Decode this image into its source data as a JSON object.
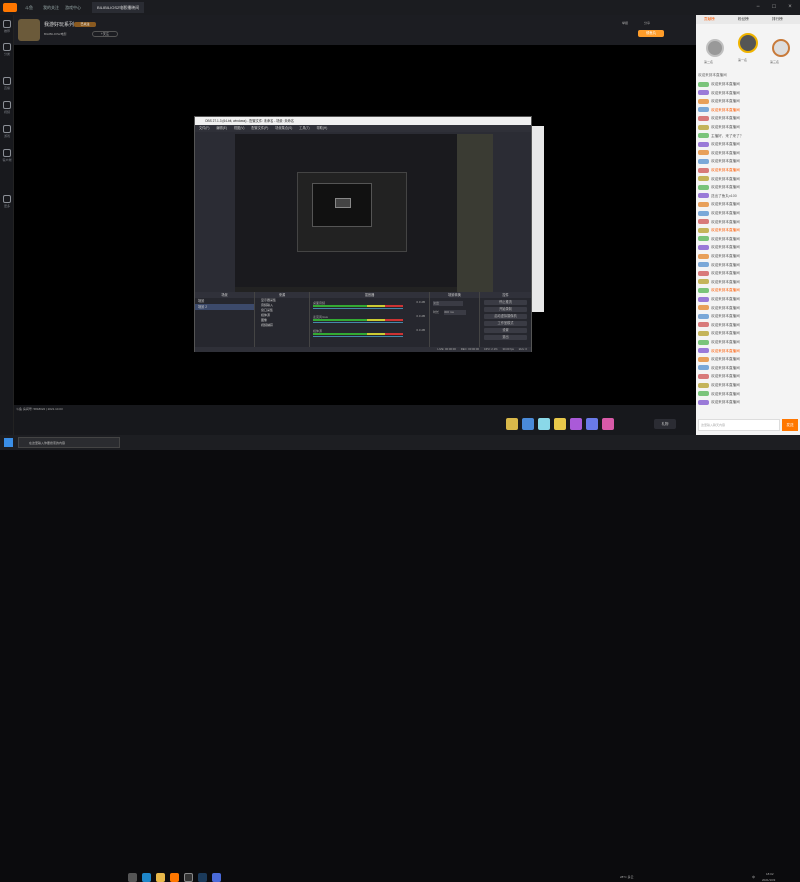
{
  "browser": {
    "tabs": [
      {
        "label": "斗鱼"
      },
      {
        "label": "我的关注"
      },
      {
        "label": "游戏中心"
      },
      {
        "label": "BILIBILIOS2电影播映间"
      }
    ],
    "window_controls": [
      "−",
      "□",
      "×"
    ]
  },
  "left_rail": {
    "items": [
      {
        "label": "推荐",
        "icon": "home-icon"
      },
      {
        "label": "分类",
        "icon": "grid-icon"
      },
      {
        "label": "直播",
        "icon": "live-icon"
      },
      {
        "label": "视频",
        "icon": "video-icon"
      },
      {
        "label": "游戏",
        "icon": "game-icon"
      },
      {
        "label": "客户端",
        "icon": "download-icon"
      },
      {
        "label": "更多",
        "icon": "menu-icon"
      }
    ]
  },
  "room_header": {
    "streamer_name": "我游好玩系列",
    "room_info": "BILIBILIOS2电影",
    "follow_button": "+关注",
    "follower_badge": "已关注",
    "report_label": "举报",
    "share_label": "分享",
    "gift_label": "领鱼丸"
  },
  "obs_window": {
    "title": "OBS 27.1.3 (64-bit, windows) - 配置文件: 未命名 - 场景: 未命名",
    "menu": [
      "文件(F)",
      "编辑(E)",
      "视图(V)",
      "配置文件(P)",
      "场景集合(S)",
      "工具(T)",
      "帮助(H)"
    ],
    "docks": {
      "scenes_header": "场景",
      "sources_header": "来源",
      "mixer_header": "混音器",
      "transitions_header": "场景转换",
      "controls_header": "控件"
    },
    "scenes": [
      "场景",
      "场景 2"
    ],
    "sources": [
      "显示器采集",
      "音频输入",
      "窗口采集",
      "媒体源",
      "图像",
      "视频捕获"
    ],
    "mixer_tracks": [
      {
        "name": "桌面音频",
        "level": "0.0 dB"
      },
      {
        "name": "麦克风/Aux",
        "level": "0.0 dB"
      },
      {
        "name": "媒体源",
        "level": "0.0 dB"
      }
    ],
    "transition": {
      "type": "淡出",
      "duration_label": "时长",
      "duration": "300 ms"
    },
    "control_buttons": [
      "停止推流",
      "开始录制",
      "启动虚拟摄像机",
      "工作室模式",
      "设置",
      "退出"
    ],
    "status": {
      "live": "LIVE: 00:00:00",
      "rec": "REC: 00:00:00",
      "cpu": "CPU: 2.1%",
      "fps": "30.00 fps",
      "kbps": "kb/s: 0"
    }
  },
  "room_footer": {
    "room_id_text": "斗鱼 房间号: 5818022 | 2021.10.03",
    "send_gift": "礼物"
  },
  "right_panel": {
    "tabs": [
      "贡献榜",
      "粉丝榜",
      "排行榜"
    ],
    "rankers": [
      {
        "name": "第一名"
      },
      {
        "name": "第二名"
      },
      {
        "name": "第三名"
      }
    ],
    "chat_header": "欢迎来到本直播间",
    "chat_messages": [
      "欢迎来到本直播间",
      "欢迎来到本直播间",
      "欢迎来到本直播间",
      "欢迎来到本直播间",
      "欢迎来到本直播间",
      "欢迎来到本直播间",
      "主播好，来了来了？",
      "欢迎来到本直播间",
      "欢迎来到本直播间",
      "欢迎来到本直播间",
      "欢迎来到本直播间",
      "欢迎来到本直播间",
      "欢迎来到本直播间",
      "送出了鱼丸x100",
      "欢迎来到本直播间",
      "欢迎来到本直播间",
      "欢迎来到本直播间",
      "欢迎来到本直播间",
      "欢迎来到本直播间",
      "欢迎来到本直播间",
      "欢迎来到本直播间",
      "欢迎来到本直播间",
      "欢迎来到本直播间",
      "欢迎来到本直播间",
      "欢迎来到本直播间",
      "欢迎来到本直播间",
      "欢迎来到本直播间",
      "欢迎来到本直播间",
      "欢迎来到本直播间",
      "欢迎来到本直播间",
      "欢迎来到本直播间",
      "欢迎来到本直播间",
      "欢迎来到本直播间",
      "欢迎来到本直播间",
      "欢迎来到本直播间",
      "欢迎来到本直播间",
      "欢迎来到本直播间",
      "欢迎来到本直播间"
    ],
    "chat_input_placeholder": "这里输入聊天内容",
    "send_button": "发送"
  },
  "taskbar": {
    "search_placeholder": "在这里输入你要搜索的内容",
    "weather": "28°C 多云",
    "time": "18:02",
    "date": "2021/10/3",
    "ime": "中"
  },
  "colors": {
    "accent": "#ff7700",
    "rail_bg": "#18191d",
    "panel_bg": "#f4f4f4",
    "obs_bg": "#2b2c34"
  }
}
